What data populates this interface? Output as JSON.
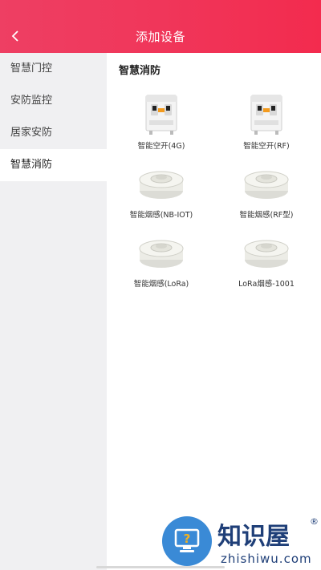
{
  "header": {
    "title": "添加设备",
    "back_icon": "chevron-left-icon",
    "gradient_colors": [
      "#ee3f63",
      "#f32b4e"
    ]
  },
  "sidebar": {
    "items": [
      {
        "label": "智慧门控",
        "active": false
      },
      {
        "label": "安防监控",
        "active": false
      },
      {
        "label": "居家安防",
        "active": false
      },
      {
        "label": "智慧消防",
        "active": true
      }
    ]
  },
  "main": {
    "section_title": "智慧消防",
    "devices": [
      {
        "label": "智能空开(4G)",
        "icon": "circuit-breaker-icon"
      },
      {
        "label": "智能空开(RF)",
        "icon": "circuit-breaker-icon"
      },
      {
        "label": "智能烟感(NB-IOT)",
        "icon": "smoke-detector-icon"
      },
      {
        "label": "智能烟感(RF型)",
        "icon": "smoke-detector-icon"
      },
      {
        "label": "智能烟感(LoRa)",
        "icon": "smoke-detector-icon"
      },
      {
        "label": "LoRa烟感-1001",
        "icon": "smoke-detector-icon"
      }
    ]
  },
  "watermark": {
    "name": "知识屋",
    "registered": "®",
    "url": "zhishiwu.com"
  }
}
